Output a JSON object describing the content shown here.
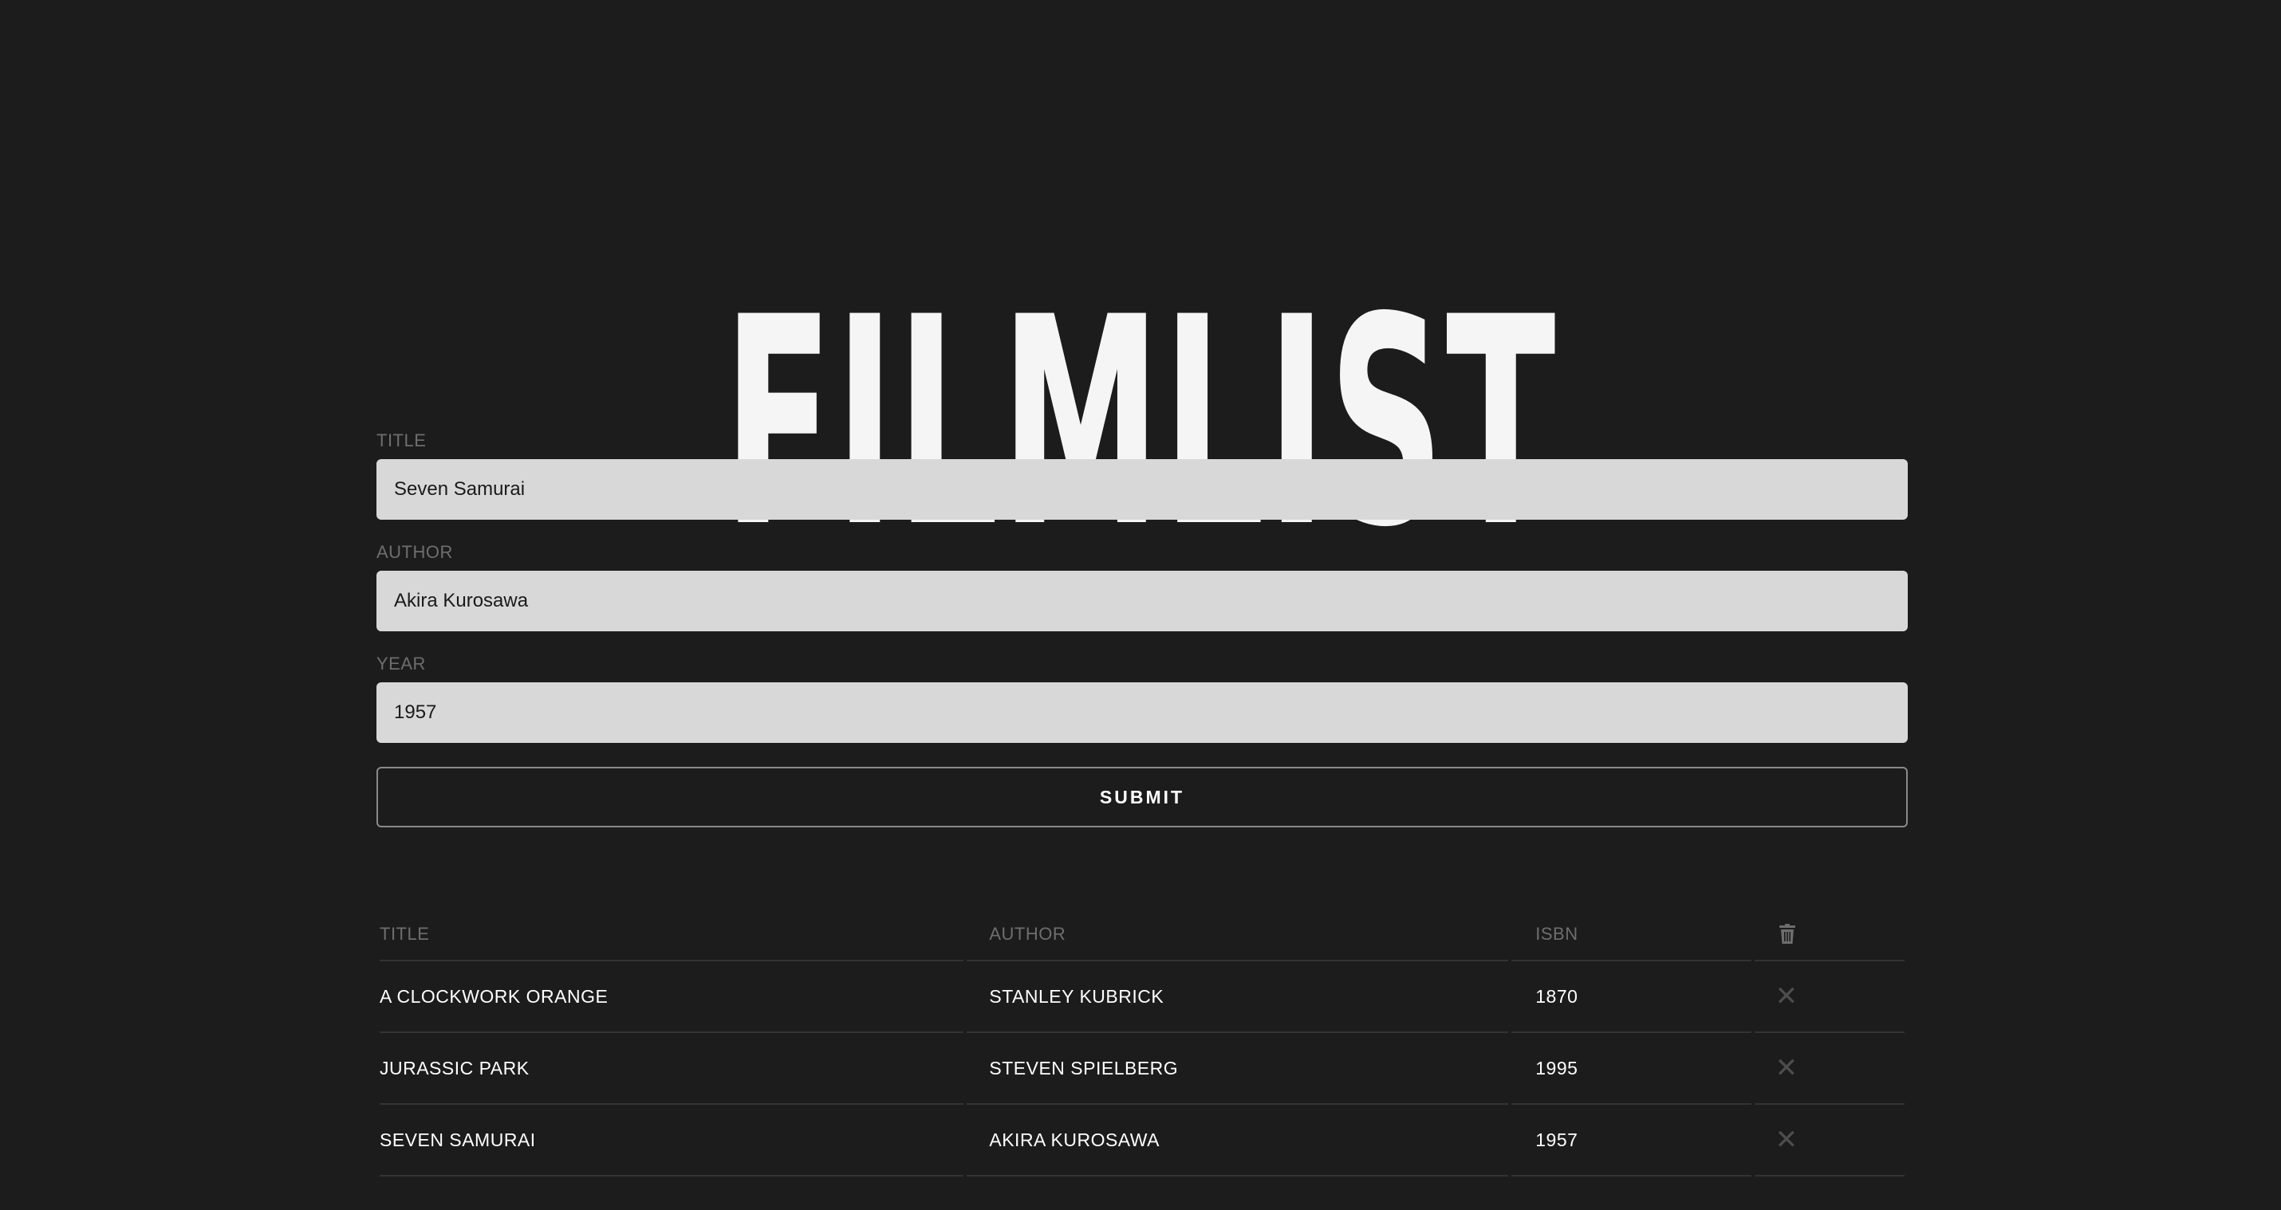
{
  "header": {
    "title": "FILMLIST"
  },
  "form": {
    "title_label": "TITLE",
    "title_value": "Seven Samurai",
    "author_label": "AUTHOR",
    "author_value": "Akira Kurosawa",
    "year_label": "YEAR",
    "year_value": "1957",
    "submit_label": "SUBMIT"
  },
  "table": {
    "columns": {
      "title": "TITLE",
      "author": "AUTHOR",
      "isbn": "ISBN",
      "action_icon": "trash-icon"
    },
    "delete_icon_glyph": "✕",
    "rows": [
      {
        "title": "A CLOCKWORK ORANGE",
        "author": "STANLEY KUBRICK",
        "isbn": "1870"
      },
      {
        "title": "JURASSIC PARK",
        "author": "STEVEN SPIELBERG",
        "isbn": "1995"
      },
      {
        "title": "SEVEN SAMURAI",
        "author": "AKIRA KUROSAWA",
        "isbn": "1957"
      }
    ]
  },
  "colors": {
    "background": "#1c1c1c",
    "input_background": "#d8d8d8",
    "label": "#6e6e6e",
    "text": "#ffffff"
  }
}
